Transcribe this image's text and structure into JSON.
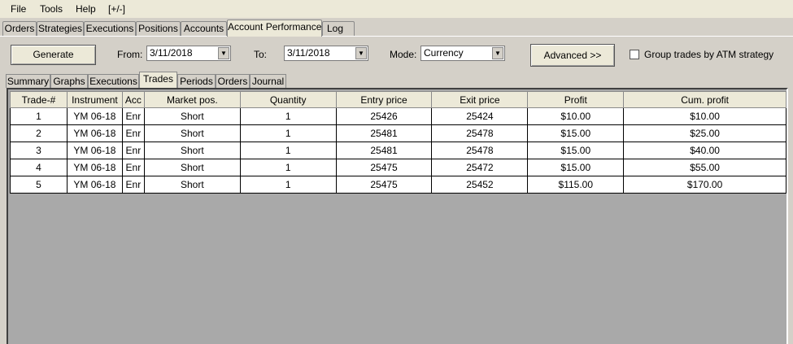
{
  "menu": {
    "items": [
      "File",
      "Tools",
      "Help",
      "[+/-]"
    ]
  },
  "tabs": [
    "Orders",
    "Strategies",
    "Executions",
    "Positions",
    "Accounts",
    "Account Performance",
    "Log"
  ],
  "active_tab": "Account Performance",
  "toolbar": {
    "generate_label": "Generate",
    "from_label": "From:",
    "from_value": "3/11/2018",
    "to_label": "To:",
    "to_value": "3/11/2018",
    "mode_label": "Mode:",
    "mode_value": "Currency",
    "advanced_label": "Advanced >>",
    "group_label": "Group trades by ATM strategy",
    "group_checked": false
  },
  "subtabs": [
    "Summary",
    "Graphs",
    "Executions",
    "Trades",
    "Periods",
    "Orders",
    "Journal"
  ],
  "active_subtab": "Trades",
  "table": {
    "columns": [
      "Trade-#",
      "Instrument",
      "Acc",
      "Market pos.",
      "Quantity",
      "Entry price",
      "Exit price",
      "Profit",
      "Cum. profit"
    ],
    "rows": [
      [
        "1",
        "YM 06-18",
        "Enr",
        "Short",
        "1",
        "25426",
        "25424",
        "$10.00",
        "$10.00"
      ],
      [
        "2",
        "YM 06-18",
        "Enr",
        "Short",
        "1",
        "25481",
        "25478",
        "$15.00",
        "$25.00"
      ],
      [
        "3",
        "YM 06-18",
        "Enr",
        "Short",
        "1",
        "25481",
        "25478",
        "$15.00",
        "$40.00"
      ],
      [
        "4",
        "YM 06-18",
        "Enr",
        "Short",
        "1",
        "25475",
        "25472",
        "$15.00",
        "$55.00"
      ],
      [
        "5",
        "YM 06-18",
        "Enr",
        "Short",
        "1",
        "25475",
        "25452",
        "$115.00",
        "$170.00"
      ]
    ]
  },
  "colors": {
    "window": "#d4d0c8",
    "grid_empty": "#a9a9a9",
    "active_tab": "#ece9d8"
  },
  "icons": {
    "dropdown": "dropdown-arrow-icon"
  }
}
